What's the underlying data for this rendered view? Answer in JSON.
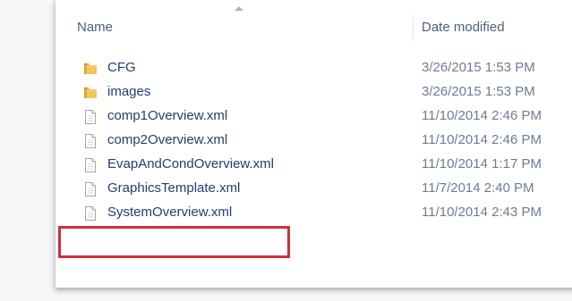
{
  "columns": {
    "name": "Name",
    "date_modified": "Date modified"
  },
  "files": [
    {
      "name": "CFG",
      "date": "3/26/2015 1:53 PM",
      "type": "folder",
      "icon": "folder-icon"
    },
    {
      "name": "images",
      "date": "3/26/2015 1:53 PM",
      "type": "folder",
      "icon": "folder-icon"
    },
    {
      "name": "comp1Overview.xml",
      "date": "11/10/2014 2:46 PM",
      "type": "file",
      "icon": "xml-file-icon"
    },
    {
      "name": "comp2Overview.xml",
      "date": "11/10/2014 2:46 PM",
      "type": "file",
      "icon": "xml-file-icon"
    },
    {
      "name": "EvapAndCondOverview.xml",
      "date": "11/10/2014 1:17 PM",
      "type": "file",
      "icon": "xml-file-icon"
    },
    {
      "name": "GraphicsTemplate.xml",
      "date": "11/7/2014 2:40 PM",
      "type": "file",
      "icon": "xml-file-icon"
    },
    {
      "name": "SystemOverview.xml",
      "date": "11/10/2014 2:43 PM",
      "type": "file",
      "icon": "xml-file-icon",
      "highlighted": true
    }
  ],
  "colors": {
    "highlight_border": "#d12f3a",
    "filename_text": "#1e3f75",
    "date_text": "#6b7c94",
    "header_text": "#4c607a"
  }
}
